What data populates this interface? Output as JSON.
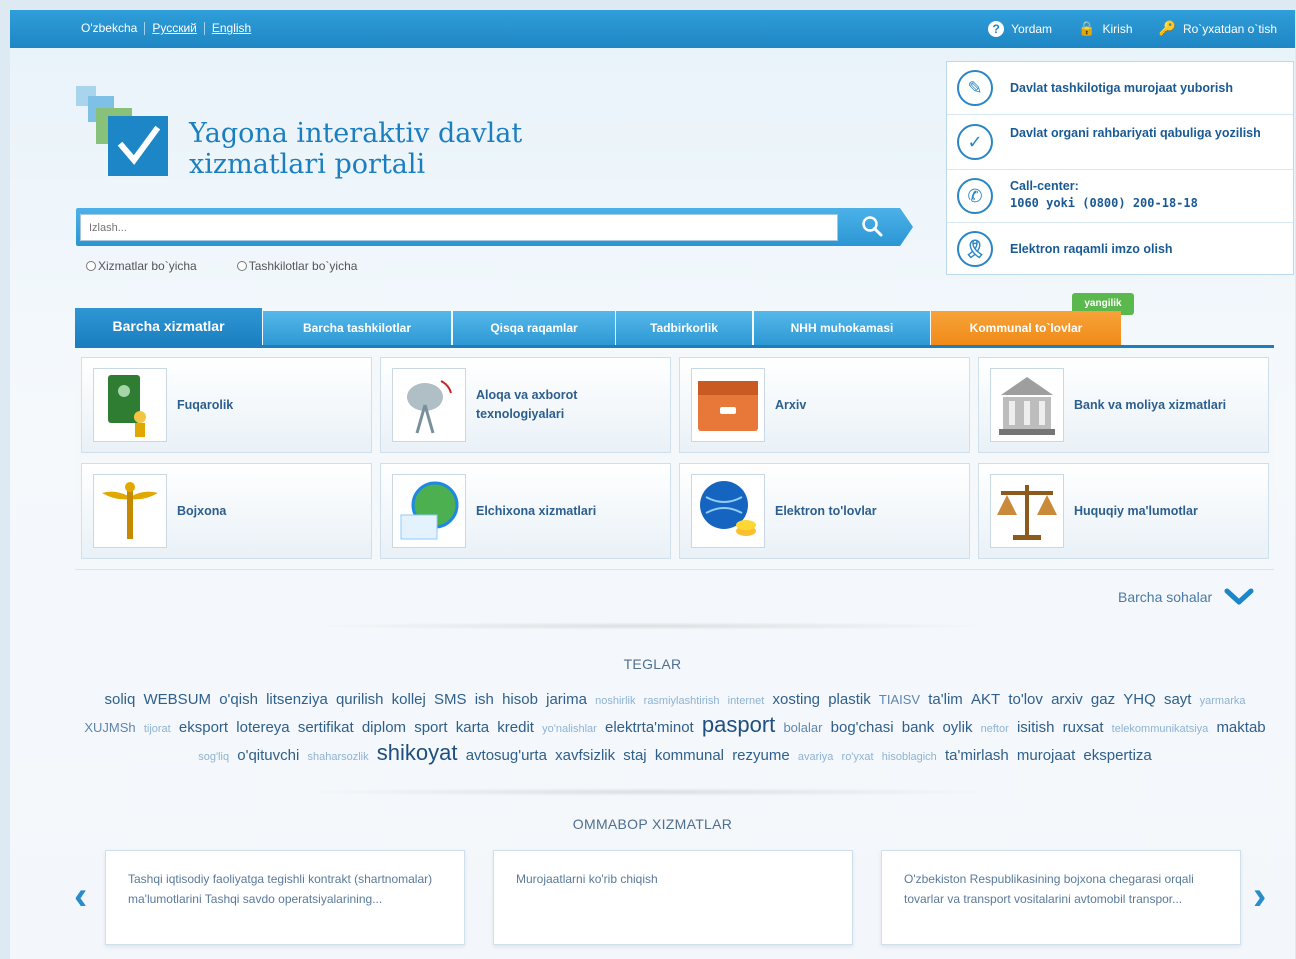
{
  "topbar": {
    "languages": [
      "O'zbekcha",
      "Русский",
      "English"
    ],
    "help": "Yordam",
    "login": "Kirish",
    "register": "Ro`yxatdan o`tish"
  },
  "logo": {
    "line1": "Yagona interaktiv davlat",
    "line2": "xizmatlari portali"
  },
  "info": [
    {
      "icon": "edit-document-icon",
      "text": "Davlat tashkilotiga murojaat yuborish"
    },
    {
      "icon": "check-circle-icon",
      "text": "Davlat organi rahbariyati qabuliga yozilish"
    },
    {
      "icon": "phone-icon",
      "text1": "Call-center:",
      "text2": "1060 yoki (0800) 200-18-18"
    },
    {
      "icon": "ribbon-icon",
      "text": "Elektron raqamli imzo olish"
    }
  ],
  "search": {
    "placeholder": "Izlash...",
    "option1": "Xizmatlar bo`yicha",
    "option2": "Tashkilotlar bo`yicha"
  },
  "tabs": [
    "Barcha xizmatlar",
    "Barcha tashkilotlar",
    "Qisqa raqamlar",
    "Tadbirkorlik",
    "NHH muhokamasi",
    "Kommunal to`lovlar"
  ],
  "new_badge": "yangilik",
  "services": [
    "Fuqarolik",
    "Aloqa va axborot texnologiyalari",
    "Arxiv",
    "Bank va moliya xizmatlari",
    "Bojxona",
    "Elchixona xizmatlari",
    "Elektron to'lovlar",
    "Huquqiy ma'lumotlar"
  ],
  "all_areas": "Barcha sohalar",
  "tags_title": "TEGLAR",
  "tags": [
    {
      "t": "soliq",
      "s": "md"
    },
    {
      "t": "WEBSUM",
      "s": "md"
    },
    {
      "t": "o'qish",
      "s": "md"
    },
    {
      "t": "litsenziya",
      "s": "md"
    },
    {
      "t": "qurilish",
      "s": "md"
    },
    {
      "t": "kollej",
      "s": "md"
    },
    {
      "t": "SMS",
      "s": "md"
    },
    {
      "t": "ish",
      "s": "md"
    },
    {
      "t": "hisob",
      "s": "md"
    },
    {
      "t": "jarima",
      "s": "md"
    },
    {
      "t": "noshirlik",
      "s": "xs"
    },
    {
      "t": "rasmiylashtirish",
      "s": "xs"
    },
    {
      "t": "internet",
      "s": "xs"
    },
    {
      "t": "xosting",
      "s": "md"
    },
    {
      "t": "plastik",
      "s": "md"
    },
    {
      "t": "TIAISV",
      "s": "sm"
    },
    {
      "t": "ta'lim",
      "s": "md"
    },
    {
      "t": "AKT",
      "s": "md"
    },
    {
      "t": "to'lov",
      "s": "md"
    },
    {
      "t": "arxiv",
      "s": "md"
    },
    {
      "t": "gaz",
      "s": "md"
    },
    {
      "t": "YHQ",
      "s": "md"
    },
    {
      "t": "sayt",
      "s": "md"
    },
    {
      "t": "yarmarka",
      "s": "xs"
    },
    {
      "t": "XUJMSh",
      "s": "sm"
    },
    {
      "t": "tijorat",
      "s": "xs"
    },
    {
      "t": "eksport",
      "s": "md"
    },
    {
      "t": "lotereya",
      "s": "md"
    },
    {
      "t": "sertifikat",
      "s": "md"
    },
    {
      "t": "diplom",
      "s": "md"
    },
    {
      "t": "sport",
      "s": "md"
    },
    {
      "t": "karta",
      "s": "md"
    },
    {
      "t": "kredit",
      "s": "md"
    },
    {
      "t": "yo'nalishlar",
      "s": "xs"
    },
    {
      "t": "elektrta'minot",
      "s": "md"
    },
    {
      "t": "pasport",
      "s": "xl"
    },
    {
      "t": "bolalar",
      "s": "sm"
    },
    {
      "t": "bog'chasi",
      "s": "md"
    },
    {
      "t": "bank",
      "s": "md"
    },
    {
      "t": "oylik",
      "s": "md"
    },
    {
      "t": "neftor",
      "s": "xs"
    },
    {
      "t": "isitish",
      "s": "md"
    },
    {
      "t": "ruxsat",
      "s": "md"
    },
    {
      "t": "telekommunikatsiya",
      "s": "xs"
    },
    {
      "t": "maktab",
      "s": "md"
    },
    {
      "t": "sog'liq",
      "s": "xs"
    },
    {
      "t": "o'qituvchi",
      "s": "md"
    },
    {
      "t": "shaharsozlik",
      "s": "xs"
    },
    {
      "t": "shikoyat",
      "s": "xl"
    },
    {
      "t": "avtosug'urta",
      "s": "md"
    },
    {
      "t": "xavfsizlik",
      "s": "md"
    },
    {
      "t": "staj",
      "s": "md"
    },
    {
      "t": "kommunal",
      "s": "md"
    },
    {
      "t": "rezyume",
      "s": "md"
    },
    {
      "t": "avariya",
      "s": "xs"
    },
    {
      "t": "ro'yxat",
      "s": "xs"
    },
    {
      "t": "hisoblagich",
      "s": "xs"
    },
    {
      "t": "ta'mirlash",
      "s": "md"
    },
    {
      "t": "murojaat",
      "s": "md"
    },
    {
      "t": "ekspertiza",
      "s": "md"
    }
  ],
  "popular_title": "OMMABOP XIZMATLAR",
  "popular": [
    "Tashqi iqtisodiy faoliyatga tegishli kontrakt (shartnomalar) ma'lumotlarini Tashqi savdo operatsiyalarining...",
    "Murojaatlarni ko'rib chiqish",
    "O'zbekiston Respublikasining bojxona chegarasi orqali tovarlar va transport vositalarini avtomobil transpor..."
  ],
  "colors": {
    "brand_blue": "#1e86c4",
    "tab_orange": "#f08a17",
    "new_badge_green": "#5bb84c"
  }
}
